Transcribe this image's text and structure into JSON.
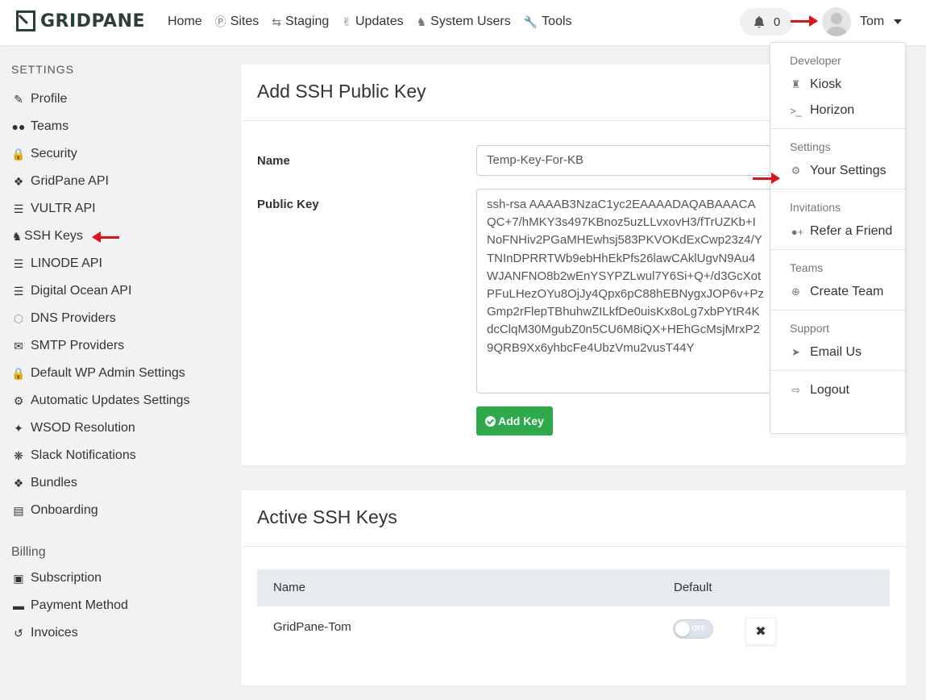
{
  "brand": {
    "name": "GRIDPANE"
  },
  "nav": {
    "items": [
      {
        "label": "Home",
        "icon": ""
      },
      {
        "label": "Sites",
        "icon": "wordpress-icon"
      },
      {
        "label": "Staging",
        "icon": "retweet-icon"
      },
      {
        "label": "Updates",
        "icon": "thumbs-up-icon"
      },
      {
        "label": "System Users",
        "icon": "user-secret-icon"
      },
      {
        "label": "Tools",
        "icon": "wrench-icon"
      }
    ],
    "notifications_count": "0",
    "user_name": "Tom"
  },
  "sidebar": {
    "settings_heading": "SETTINGS",
    "items": [
      {
        "label": "Profile"
      },
      {
        "label": "Teams"
      },
      {
        "label": "Security"
      },
      {
        "label": "GridPane API"
      },
      {
        "label": "VULTR API"
      },
      {
        "label": "SSH Keys"
      },
      {
        "label": "LINODE API"
      },
      {
        "label": "Digital Ocean API"
      },
      {
        "label": "DNS Providers"
      },
      {
        "label": "SMTP Providers"
      },
      {
        "label": "Default WP Admin Settings"
      },
      {
        "label": "Automatic Updates Settings"
      },
      {
        "label": "WSOD Resolution"
      },
      {
        "label": "Slack Notifications"
      },
      {
        "label": "Bundles"
      },
      {
        "label": "Onboarding"
      }
    ],
    "billing_heading": "Billing",
    "billing_items": [
      {
        "label": "Subscription"
      },
      {
        "label": "Payment Method"
      },
      {
        "label": "Invoices"
      }
    ]
  },
  "add_key": {
    "title": "Add SSH Public Key",
    "name_label": "Name",
    "name_value": "Temp-Key-For-KB",
    "public_key_label": "Public Key",
    "public_key_value": "ssh-rsa AAAAB3NzaC1yc2EAAAADAQABAAACAQC+7/hMKY3s497KBnoz5uzLLvxovH3/fTrUZKb+INoFNHiv2PGaMHEwhsj583PKVOKdExCwp23z4/YTNInDPRRTWb9ebHhEkPfs26lawCAklUgvN9Au4WJANFNO8b2wEnYSYPZLwul7Y6Si+Q+/d3GcXotPFuLHezOYu8OjJy4Qpx6pC88hEBNygxJOP6v+PzGmp2rFlepTBhuhwZILkfDe0uisKx8oLg7xbPYtR4KdcClqM30MgubZ0n5CU6M8iQX+HEhGcMsjMrxP29QRB9Xx6yhbcFe4UbzVmu2vusT44Y",
    "submit_label": "Add Key"
  },
  "active_keys": {
    "title": "Active SSH Keys",
    "columns": [
      "Name",
      "Default"
    ],
    "rows": [
      {
        "name": "GridPane-Tom",
        "default_toggle": "OFF"
      }
    ]
  },
  "user_menu": {
    "sections": [
      {
        "heading": "Developer",
        "items": [
          {
            "label": "Kiosk",
            "icon": "castle-icon"
          },
          {
            "label": "Horizon",
            "icon": "terminal-icon"
          }
        ]
      },
      {
        "heading": "Settings",
        "items": [
          {
            "label": "Your Settings",
            "icon": "gear-icon"
          }
        ]
      },
      {
        "heading": "Invitations",
        "items": [
          {
            "label": "Refer a Friend",
            "icon": "user-plus-icon"
          }
        ]
      },
      {
        "heading": "Teams",
        "items": [
          {
            "label": "Create Team",
            "icon": "plus-circle-icon"
          }
        ]
      },
      {
        "heading": "Support",
        "items": [
          {
            "label": "Email Us",
            "icon": "paper-plane-icon"
          }
        ]
      },
      {
        "heading": "",
        "items": [
          {
            "label": "Logout",
            "icon": "sign-out-icon"
          }
        ]
      }
    ]
  },
  "colors": {
    "accent_green": "#2eaa4a",
    "annotation_red": "#e0101c",
    "page_bg": "#f1f2f3"
  }
}
